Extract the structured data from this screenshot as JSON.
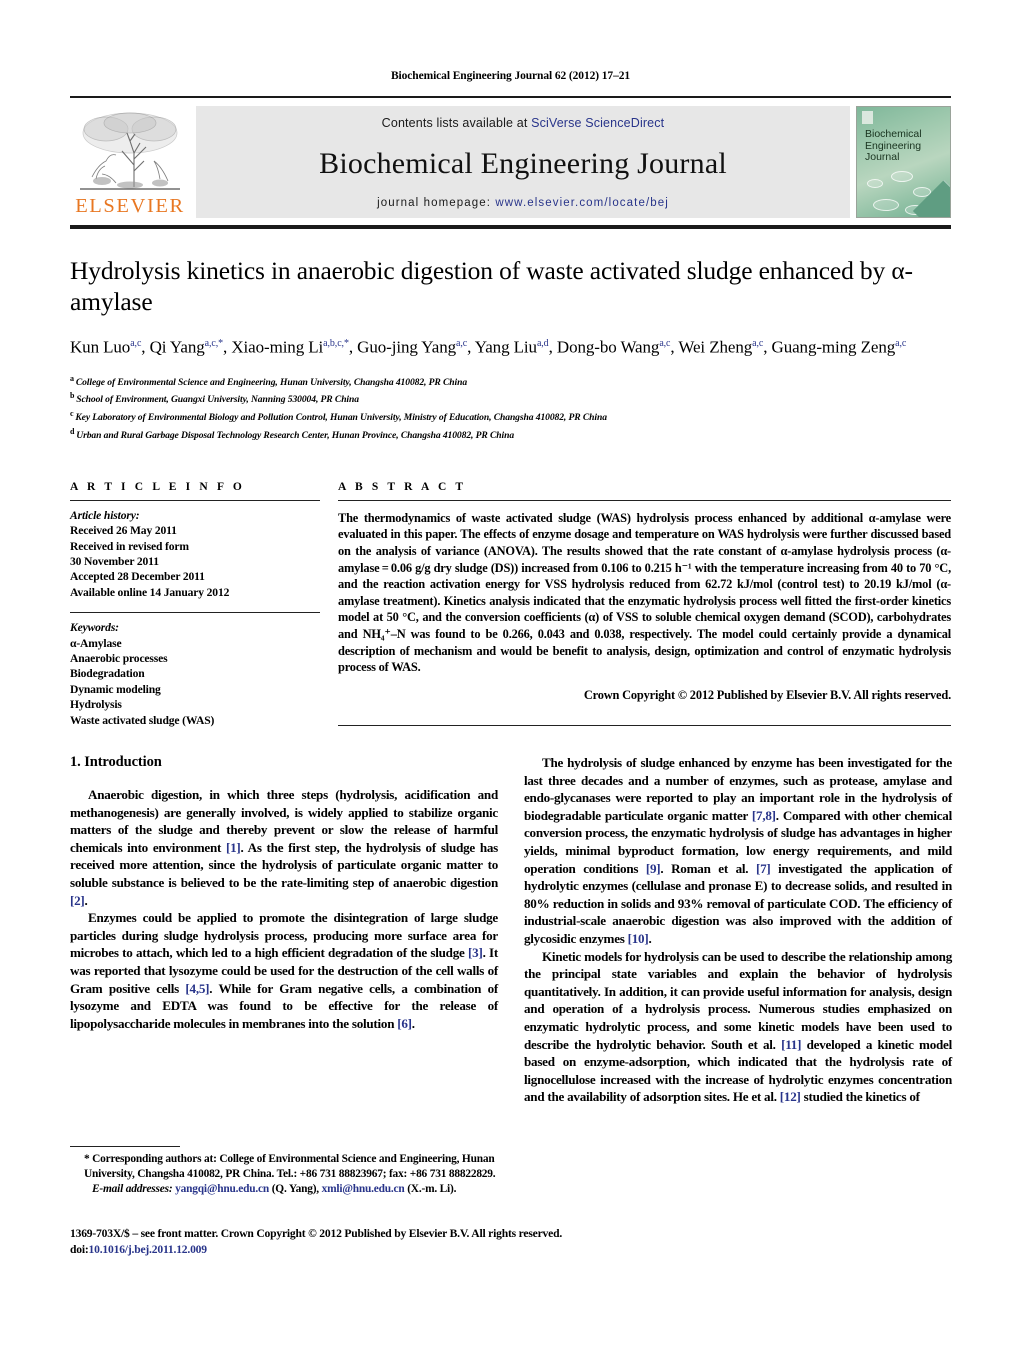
{
  "running_head": "Biochemical Engineering Journal 62 (2012) 17–21",
  "masthead": {
    "publisher_logo_label": "ELSEVIER",
    "contents_prefix": "Contents lists available at ",
    "contents_link": "SciVerse ScienceDirect",
    "journal_title": "Biochemical Engineering Journal",
    "homepage_prefix": "journal homepage: ",
    "homepage_url": "www.elsevier.com/locate/bej",
    "cover_title_line1": "Biochemical",
    "cover_title_line2": "Engineering",
    "cover_title_line3": "Journal"
  },
  "article": {
    "title": "Hydrolysis kinetics in anaerobic digestion of waste activated sludge enhanced by α-amylase",
    "authors_line1": "Kun Luo",
    "authors": [
      {
        "name": "Kun Luo",
        "sup": "a,c",
        "sep": ", "
      },
      {
        "name": "Qi Yang",
        "sup": "a,c,*",
        "sep": ", "
      },
      {
        "name": "Xiao-ming Li",
        "sup": "a,b,c,*",
        "sep": ", "
      },
      {
        "name": "Guo-jing Yang",
        "sup": "a,c",
        "sep": ", "
      },
      {
        "name": "Yang Liu",
        "sup": "a,d",
        "sep": ", "
      },
      {
        "name": "Dong-bo Wang",
        "sup": "a,c",
        "sep": ","
      },
      {
        "name": "Wei Zheng",
        "sup": "a,c",
        "sep": ", "
      },
      {
        "name": "Guang-ming Zeng",
        "sup": "a,c",
        "sep": ""
      }
    ],
    "affiliations": [
      {
        "marker": "a",
        "text": "College of Environmental Science and Engineering, Hunan University, Changsha 410082, PR China"
      },
      {
        "marker": "b",
        "text": "School of Environment, Guangxi University, Nanning 530004, PR China"
      },
      {
        "marker": "c",
        "text": "Key Laboratory of Environmental Biology and Pollution Control, Hunan University, Ministry of Education, Changsha 410082, PR China"
      },
      {
        "marker": "d",
        "text": "Urban and Rural Garbage Disposal Technology Research Center, Hunan Province, Changsha 410082, PR China"
      }
    ]
  },
  "article_info": {
    "heading": "A R T I C L E    I N F O",
    "history_label": "Article history:",
    "history": [
      "Received 26 May 2011",
      "Received in revised form",
      "30 November 2011",
      "Accepted 28 December 2011",
      "Available online 14 January 2012"
    ],
    "keywords_label": "Keywords:",
    "keywords": [
      "α-Amylase",
      "Anaerobic processes",
      "Biodegradation",
      "Dynamic modeling",
      "Hydrolysis",
      "Waste activated sludge (WAS)"
    ]
  },
  "abstract": {
    "heading": "A B S T R A C T",
    "text": "The thermodynamics of waste activated sludge (WAS) hydrolysis process enhanced by additional α-amylase were evaluated in this paper. The effects of enzyme dosage and temperature on WAS hydrolysis were further discussed based on the analysis of variance (ANOVA). The results showed that the rate constant of α-amylase hydrolysis process (α-amylase = 0.06 g/g dry sludge (DS)) increased from 0.106 to 0.215 h⁻¹ with the temperature increasing from 40 to 70 °C, and the reaction activation energy for VSS hydrolysis reduced from 62.72 kJ/mol (control test) to 20.19 kJ/mol (α-amylase treatment). Kinetics analysis indicated that the enzymatic hydrolysis process well fitted the first-order kinetics model at 50 °C, and the conversion coefficients (α) of VSS to soluble chemical oxygen demand (SCOD), carbohydrates and NH₄⁺–N was found to be 0.266, 0.043 and 0.038, respectively. The model could certainly provide a dynamical description of mechanism and would be benefit to analysis, design, optimization and control of enzymatic hydrolysis process of WAS.",
    "copyright": "Crown Copyright © 2012 Published by Elsevier B.V. All rights reserved."
  },
  "body": {
    "section_heading": "1.  Introduction",
    "left_paragraphs": [
      "Anaerobic digestion, in which three steps (hydrolysis, acidification and methanogenesis) are generally involved, is widely applied to stabilize organic matters of the sludge and thereby prevent or slow the release of harmful chemicals into environment [1]. As the first step, the hydrolysis of sludge has received more attention, since the hydrolysis of particulate organic matter to soluble substance is believed to be the rate-limiting step of anaerobic digestion [2].",
      "Enzymes could be applied to promote the disintegration of large sludge particles during sludge hydrolysis process, producing more surface area for microbes to attach, which led to a high efficient degradation of the sludge [3]. It was reported that lysozyme could be used for the destruction of the cell walls of Gram positive cells [4,5]. While for Gram negative cells, a combination of lysozyme and EDTA was found to be effective for the release of lipopolysaccharide molecules in membranes into the solution [6]."
    ],
    "right_paragraphs": [
      "The hydrolysis of sludge enhanced by enzyme has been investigated for the last three decades and a number of enzymes, such as protease, amylase and endo-glycanases were reported to play an important role in the hydrolysis of biodegradable particulate organic matter [7,8]. Compared with other chemical conversion process, the enzymatic hydrolysis of sludge has advantages in higher yields, minimal byproduct formation, low energy requirements, and mild operation conditions [9]. Roman et al. [7] investigated the application of hydrolytic enzymes (cellulase and pronase E) to decrease solids, and resulted in 80% reduction in solids and 93% removal of particulate COD. The efficiency of industrial-scale anaerobic digestion was also improved with the addition of glycosidic enzymes [10].",
      "Kinetic models for hydrolysis can be used to describe the relationship among the principal state variables and explain the behavior of hydrolysis quantitatively. In addition, it can provide useful information for analysis, design and operation of a hydrolysis process. Numerous studies emphasized on enzymatic hydrolytic process, and some kinetic models have been used to describe the hydrolytic behavior. South et al. [11] developed a kinetic model based on enzyme-adsorption, which indicated that the hydrolysis rate of lignocellulose increased with the increase of hydrolytic enzymes concentration and the availability of adsorption sites. He et al. [12] studied the kinetics of"
    ]
  },
  "footnote": {
    "corresponding": "* Corresponding authors at: College of Environmental Science and Engineering, Hunan University, Changsha 410082, PR China. Tel.: +86 731 88823967; fax: +86 731 88822829.",
    "email_label": "E-mail addresses:",
    "email1": "yangqi@hnu.edu.cn",
    "email1_owner": "(Q. Yang),",
    "email2": "xmli@hnu.edu.cn",
    "email2_owner": "(X.-m. Li)."
  },
  "page_footer": {
    "issn_line": "1369-703X/$ – see front matter. Crown Copyright © 2012 Published by Elsevier B.V. All rights reserved.",
    "doi_prefix": "doi:",
    "doi_value": "10.1016/j.bej.2011.12.009"
  },
  "colors": {
    "link": "#28348A",
    "elsevier_orange": "#E87722",
    "masthead_bg": "#e7e7e7"
  }
}
